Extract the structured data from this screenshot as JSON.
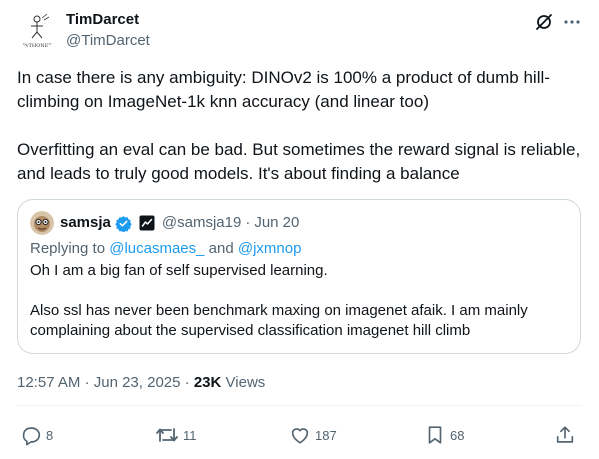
{
  "author": {
    "name": "TimDarcet",
    "handle": "@TimDarcet",
    "avatar_text": "PyTHONET"
  },
  "tweet": {
    "text": "In case there is any ambiguity: DINOv2 is 100% a product of dumb hill-climbing on ImageNet-1k knn accuracy (and linear too)\n\nOverfitting an eval can be bad. But sometimes the reward signal is reliable, and leads to truly good models. It's about finding a balance"
  },
  "quote": {
    "name": "samsja",
    "handle": "@samsja19",
    "separator": "·",
    "date": "Jun 20",
    "replying_prefix": "Replying to",
    "reply_user_1": "@lucasmaes_",
    "reply_and": "and",
    "reply_user_2": "@jxmnop",
    "text": "Oh I am a big fan of self supervised learning.\n\nAlso ssl has never been benchmark maxing on imagenet afaik. I am mainly complaining about the supervised classification imagenet hill climb"
  },
  "meta": {
    "time": "12:57 AM",
    "separator_1": "·",
    "date": "Jun 23, 2025",
    "separator_2": "·",
    "views_count": "23K",
    "views_label": "Views"
  },
  "actions": {
    "replies": "8",
    "reposts": "11",
    "likes": "187",
    "bookmarks": "68"
  },
  "icons": {
    "grok": "grok-slash-icon",
    "more": "more-icon",
    "verified": "verified-badge-icon",
    "affiliate": "affiliate-badge-icon",
    "reply": "reply-icon",
    "repost": "repost-icon",
    "like": "like-icon",
    "bookmark": "bookmark-icon",
    "share": "share-icon"
  },
  "colors": {
    "text": "#0f1419",
    "muted": "#536471",
    "link": "#1d9bf0",
    "border": "#cfd9de"
  }
}
